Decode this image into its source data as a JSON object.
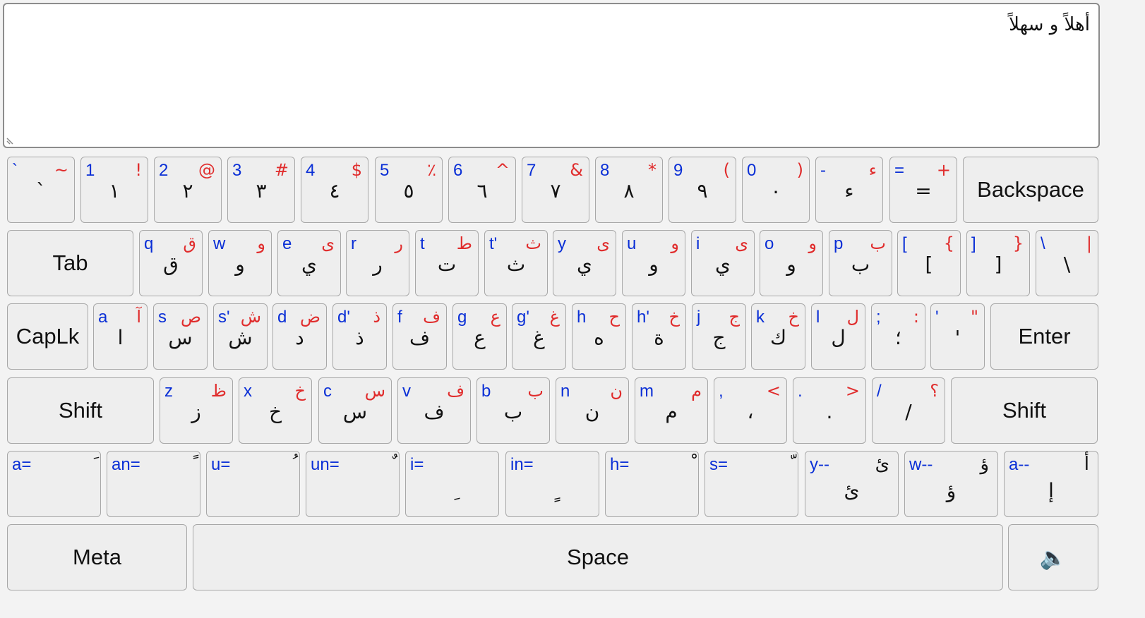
{
  "textbox": {
    "value": "أهلاً و سهلاً"
  },
  "row1": [
    {
      "tl": "`",
      "tr": "~",
      "mid": "`"
    },
    {
      "tl": "1",
      "tr": "!",
      "mid": "١"
    },
    {
      "tl": "2",
      "tr": "@",
      "mid": "٢"
    },
    {
      "tl": "3",
      "tr": "#",
      "mid": "٣"
    },
    {
      "tl": "4",
      "tr": "$",
      "mid": "٤"
    },
    {
      "tl": "5",
      "tr": "٪",
      "mid": "٥"
    },
    {
      "tl": "6",
      "tr": "^",
      "mid": "٦"
    },
    {
      "tl": "7",
      "tr": "&",
      "mid": "٧"
    },
    {
      "tl": "8",
      "tr": "*",
      "mid": "٨"
    },
    {
      "tl": "9",
      "tr": "(",
      "mid": "٩"
    },
    {
      "tl": "0",
      "tr": ")",
      "mid": "٠"
    },
    {
      "tl": "-",
      "tr": "ء",
      "mid": "ء"
    },
    {
      "tl": "=",
      "tr": "+",
      "mid": "="
    },
    {
      "label": "Backspace"
    }
  ],
  "row2": [
    {
      "label": "Tab"
    },
    {
      "tl": "q",
      "tr": "ق",
      "mid": "ق"
    },
    {
      "tl": "w",
      "tr": "و",
      "mid": "و"
    },
    {
      "tl": "e",
      "tr": "ى",
      "mid": "ي"
    },
    {
      "tl": "r",
      "tr": "ر",
      "mid": "ر"
    },
    {
      "tl": "t",
      "tr": "ط",
      "mid": "ت"
    },
    {
      "tl": "t'",
      "tr": "ث",
      "mid": "ث"
    },
    {
      "tl": "y",
      "tr": "ى",
      "mid": "ي"
    },
    {
      "tl": "u",
      "tr": "و",
      "mid": "و"
    },
    {
      "tl": "i",
      "tr": "ى",
      "mid": "ي"
    },
    {
      "tl": "o",
      "tr": "و",
      "mid": "و"
    },
    {
      "tl": "p",
      "tr": "ب",
      "mid": "ب"
    },
    {
      "tl": "[",
      "tr": "{",
      "mid": "["
    },
    {
      "tl": "]",
      "tr": "}",
      "mid": "]"
    },
    {
      "tl": "\\",
      "tr": "|",
      "mid": "\\"
    }
  ],
  "row3": [
    {
      "label": "CapLk"
    },
    {
      "tl": "a",
      "tr": "آ",
      "mid": "ا"
    },
    {
      "tl": "s",
      "tr": "ص",
      "mid": "س"
    },
    {
      "tl": "s'",
      "tr": "ش",
      "mid": "ش"
    },
    {
      "tl": "d",
      "tr": "ض",
      "mid": "د"
    },
    {
      "tl": "d'",
      "tr": "ذ",
      "mid": "ذ"
    },
    {
      "tl": "f",
      "tr": "ف",
      "mid": "ف"
    },
    {
      "tl": "g",
      "tr": "ع",
      "mid": "ع"
    },
    {
      "tl": "g'",
      "tr": "غ",
      "mid": "غ"
    },
    {
      "tl": "h",
      "tr": "ح",
      "mid": "ه"
    },
    {
      "tl": "h'",
      "tr": "خ",
      "mid": "ة"
    },
    {
      "tl": "j",
      "tr": "ج",
      "mid": "ج"
    },
    {
      "tl": "k",
      "tr": "خ",
      "mid": "ك"
    },
    {
      "tl": "l",
      "tr": "ل",
      "mid": "ل"
    },
    {
      "tl": ";",
      "tr": ":",
      "mid": "؛"
    },
    {
      "tl": "'",
      "tr": "\"",
      "mid": "'"
    },
    {
      "label": "Enter"
    }
  ],
  "row4": [
    {
      "label": "Shift"
    },
    {
      "tl": "z",
      "tr": "ظ",
      "mid": "ز"
    },
    {
      "tl": "x",
      "tr": "خ",
      "mid": "خ"
    },
    {
      "tl": "c",
      "tr": "س",
      "mid": "س"
    },
    {
      "tl": "v",
      "tr": "ف",
      "mid": "ف"
    },
    {
      "tl": "b",
      "tr": "ب",
      "mid": "ب"
    },
    {
      "tl": "n",
      "tr": "ن",
      "mid": "ن"
    },
    {
      "tl": "m",
      "tr": "م",
      "mid": "م"
    },
    {
      "tl": ",",
      "tr": "<",
      "mid": "،"
    },
    {
      "tl": ".",
      "tr": ">",
      "mid": "."
    },
    {
      "tl": "/",
      "tr": "؟",
      "mid": "/"
    },
    {
      "label": "Shift"
    }
  ],
  "row5": [
    {
      "tl": "a=",
      "tr": "َ",
      "mid": ""
    },
    {
      "tl": "an=",
      "tr": "ً",
      "mid": ""
    },
    {
      "tl": "u=",
      "tr": "ُ",
      "mid": ""
    },
    {
      "tl": "un=",
      "tr": "ٌ",
      "mid": ""
    },
    {
      "tl": "i=",
      "tr": "",
      "mid": "ِ"
    },
    {
      "tl": "in=",
      "tr": "",
      "mid": "ٍ"
    },
    {
      "tl": "h=",
      "tr": "ْ",
      "mid": ""
    },
    {
      "tl": "s=",
      "tr": "ّ",
      "mid": ""
    },
    {
      "tl": "y--",
      "tr": "ئ",
      "mid": "ئ"
    },
    {
      "tl": "w--",
      "tr": "ؤ",
      "mid": "ؤ"
    },
    {
      "tl": "a--",
      "tr": "أ",
      "mid": "إ"
    }
  ],
  "row6": [
    {
      "label": "Meta"
    },
    {
      "label": "Space"
    },
    {
      "label": "🔈"
    }
  ]
}
